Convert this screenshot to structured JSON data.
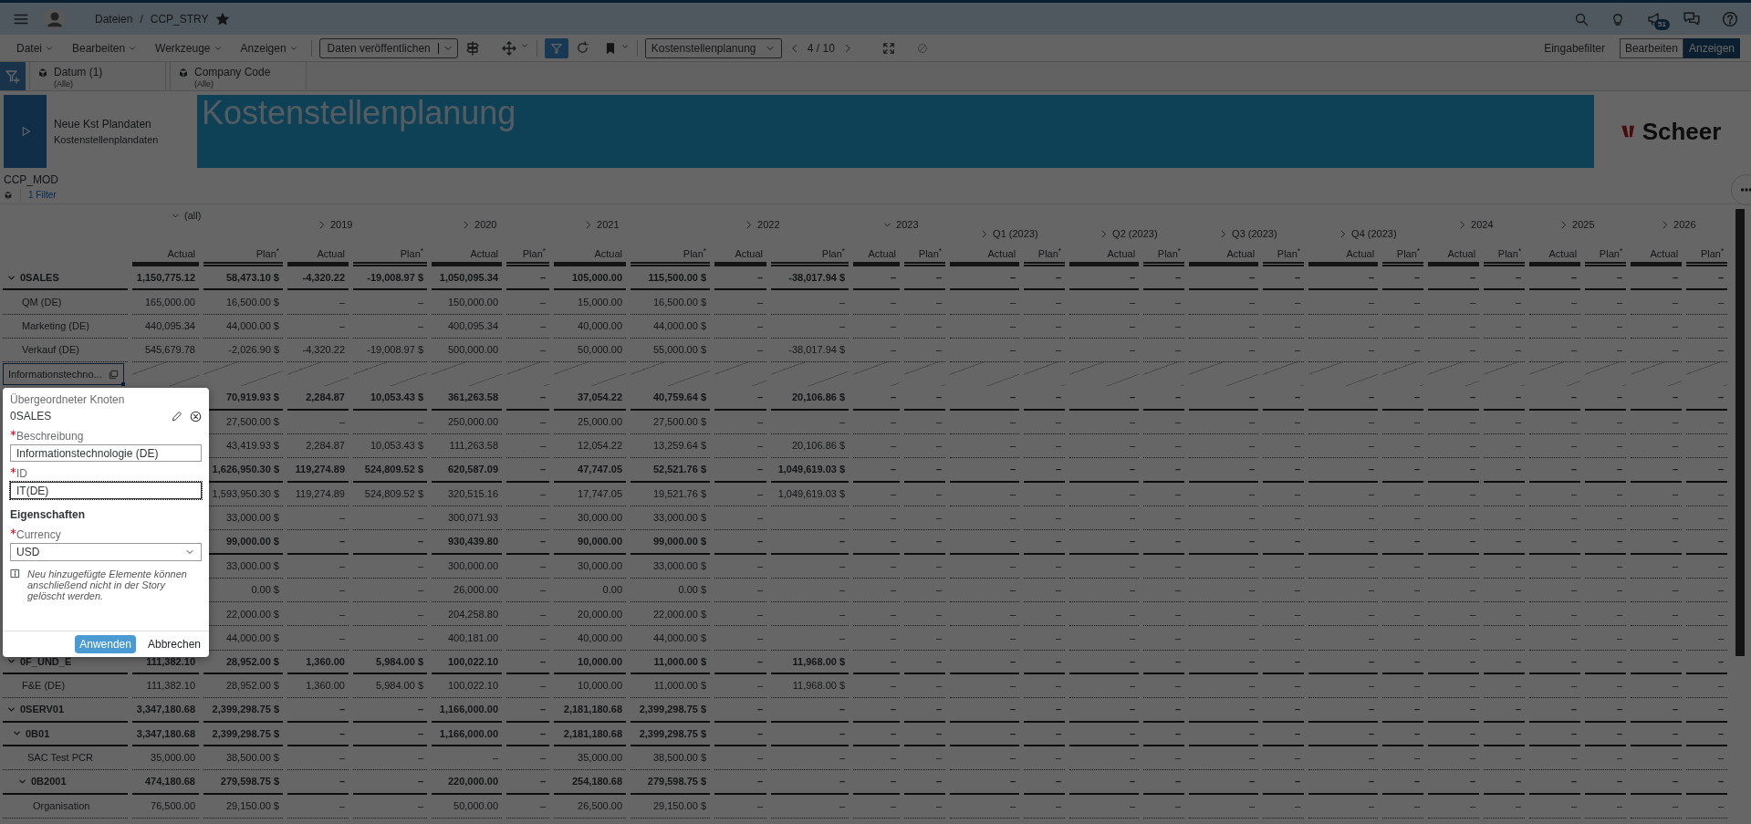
{
  "shell": {
    "breadcrumb": [
      "Dateien",
      "CCP_STRY"
    ],
    "separator": "/",
    "favorite": true,
    "badge": "51"
  },
  "menus": [
    "Datei",
    "Bearbeiten",
    "Werkzeuge",
    "Anzeigen"
  ],
  "toolbar": {
    "publish": "Daten veröffentlichen",
    "filter_active": true,
    "page": "Kostenstellenplanung",
    "pager": "4 / 10",
    "input_filter": "Eingabefilter",
    "modes": [
      {
        "label": "Bearbeiten",
        "selected": false
      },
      {
        "label": "Anzeigen",
        "selected": true
      }
    ]
  },
  "filters": [
    {
      "label": "Datum (1)",
      "value": "(Alle)"
    },
    {
      "label": "Company Code",
      "value": "(Alle)"
    }
  ],
  "story": {
    "title": "Neue Kst Plandaten",
    "subtitle": "Kostenstellenplandaten",
    "banner": "Kostenstellenplanung",
    "logo": "Scheer"
  },
  "table": {
    "title": "CCP_MOD",
    "filter_label": "1 Filter",
    "columns": {
      "label": "(all)",
      "expanded": true,
      "measures": [
        "Actual",
        "Plan$^{*}$"
      ],
      "children": [
        {
          "label": "2019",
          "expanded": false,
          "measures": [
            "Actual",
            "Plan$^{*}$"
          ]
        },
        {
          "label": "2020",
          "expanded": false,
          "measures": [
            "Actual",
            "Plan$^{*}$"
          ]
        },
        {
          "label": "2021",
          "expanded": false,
          "measures": [
            "Actual",
            "Plan$^{*}$"
          ]
        },
        {
          "label": "2022",
          "expanded": false,
          "measures": [
            "Actual",
            "Plan$^{*}$"
          ]
        },
        {
          "label": "2023",
          "expanded": true,
          "measures": [
            "Actual",
            "Plan$^{*}$"
          ],
          "children": [
            {
              "label": "Q1 (2023)",
              "expanded": false,
              "measures": [
                "Actual",
                "Plan$^{*}$"
              ]
            },
            {
              "label": "Q2 (2023)",
              "expanded": false,
              "measures": [
                "Actual",
                "Plan$^{*}$"
              ]
            },
            {
              "label": "Q3 (2023)",
              "expanded": false,
              "measures": [
                "Actual",
                "Plan$^{*}$"
              ]
            },
            {
              "label": "Q4 (2023)",
              "expanded": false,
              "measures": [
                "Actual",
                "Plan$^{*}$"
              ]
            }
          ]
        },
        {
          "label": "2024",
          "expanded": false,
          "measures": [
            "Actual",
            "Plan$^{*}$"
          ]
        },
        {
          "label": "2025",
          "expanded": false,
          "measures": [
            "Actual",
            "Plan$^{*}$"
          ]
        },
        {
          "label": "2026",
          "expanded": false,
          "measures": [
            "Actual",
            "Plan$^{*}$"
          ]
        }
      ]
    },
    "rows": [
      {
        "kind": "node",
        "label": "0SALES",
        "expanded": true,
        "cells": [
          "1,150,775.12",
          "58,473.10 $",
          "-4,320.22",
          "-19,008.97 $",
          "1,050,095.34",
          "–",
          "105,000.00",
          "115,500.00 $",
          "–",
          "-38,017.94 $",
          "–",
          "–",
          "–",
          "–",
          "–",
          "–",
          "–",
          "–",
          "–",
          "–",
          "–",
          "–",
          "–",
          "–",
          "–",
          "–"
        ],
        "children": [
          {
            "kind": "node",
            "label": "QM (DE)",
            "cells": [
              "165,000.00",
              "16,500.00 $",
              "–",
              "–",
              "150,000.00",
              "–",
              "15,000.00",
              "16,500.00 $",
              "–",
              "–",
              "–",
              "–",
              "–",
              "–",
              "–",
              "–",
              "–",
              "–",
              "–",
              "–",
              "–",
              "–",
              "–",
              "–",
              "–",
              "–"
            ]
          },
          {
            "kind": "node",
            "label": "Marketing (DE)",
            "cells": [
              "440,095.34",
              "44,000.00 $",
              "–",
              "–",
              "400,095.34",
              "–",
              "40,000.00",
              "44,000.00 $",
              "–",
              "–",
              "–",
              "–",
              "–",
              "–",
              "–",
              "–",
              "–",
              "–",
              "–",
              "–",
              "–",
              "–",
              "–",
              "–",
              "–",
              "–"
            ]
          },
          {
            "kind": "node",
            "label": "Verkauf (DE)",
            "cells": [
              "545,679.78",
              "-2,026.90 $",
              "-4,320.22",
              "-19,008.97 $",
              "500,000.00",
              "–",
              "50,000.00",
              "55,000.00 $",
              "–",
              "-38,017.94 $",
              "–",
              "–",
              "–",
              "–",
              "–",
              "–",
              "–",
              "–",
              "–",
              "–",
              "–",
              "–",
              "–",
              "–",
              "–",
              "–"
            ]
          },
          {
            "kind": "new",
            "label": "Informationstechno..."
          }
        ]
      },
      {
        "kind": "node",
        "cells": [
          null,
          "70,919.93 $",
          "2,284.87",
          "10,053.43 $",
          "361,263.58",
          "–",
          "37,054.22",
          "40,759.64 $",
          "–",
          "20,106.86 $",
          "–",
          "–",
          "–",
          "–",
          "–",
          "–",
          "–",
          "–",
          "–",
          "–",
          "–",
          "–",
          "–",
          "–",
          "–",
          "–"
        ],
        "children": [
          {
            "kind": "node",
            "cells": [
              null,
              "27,500.00 $",
              "–",
              "–",
              "250,000.00",
              "–",
              "25,000.00",
              "27,500.00 $",
              "–",
              "–",
              "–",
              "–",
              "–",
              "–",
              "–",
              "–",
              "–",
              "–",
              "–",
              "–",
              "–",
              "–",
              "–",
              "–",
              "–",
              "–"
            ]
          },
          {
            "kind": "node",
            "cells": [
              null,
              "43,419.93 $",
              "2,284.87",
              "10,053.43 $",
              "111,263.58",
              "–",
              "12,054.22",
              "13,259.64 $",
              "–",
              "20,106.86 $",
              "–",
              "–",
              "–",
              "–",
              "–",
              "–",
              "–",
              "–",
              "–",
              "–",
              "–",
              "–",
              "–",
              "–",
              "–",
              "–"
            ]
          }
        ]
      },
      {
        "kind": "node",
        "cells": [
          null,
          "1,626,950.30 $",
          "119,274.89",
          "524,809.52 $",
          "620,587.09",
          "–",
          "47,747.05",
          "52,521.76 $",
          "–",
          "1,049,619.03 $",
          "–",
          "–",
          "–",
          "–",
          "–",
          "–",
          "–",
          "–",
          "–",
          "–",
          "–",
          "–",
          "–",
          "–",
          "–",
          "–"
        ],
        "children": [
          {
            "kind": "node",
            "cells": [
              null,
              "1,593,950.30 $",
              "119,274.89",
              "524,809.52 $",
              "320,515.16",
              "–",
              "17,747.05",
              "19,521.76 $",
              "–",
              "1,049,619.03 $",
              "–",
              "–",
              "–",
              "–",
              "–",
              "–",
              "–",
              "–",
              "–",
              "–",
              "–",
              "–",
              "–",
              "–",
              "–",
              "–"
            ]
          },
          {
            "kind": "node",
            "cells": [
              null,
              "33,000.00 $",
              "–",
              "–",
              "300,071.93",
              "–",
              "30,000.00",
              "33,000.00 $",
              "–",
              "–",
              "–",
              "–",
              "–",
              "–",
              "–",
              "–",
              "–",
              "–",
              "–",
              "–",
              "–",
              "–",
              "–",
              "–",
              "–",
              "–"
            ]
          }
        ]
      },
      {
        "kind": "node",
        "cells": [
          null,
          "99,000.00 $",
          "–",
          "–",
          "930,439.80",
          "–",
          "90,000.00",
          "99,000.00 $",
          "–",
          "–",
          "–",
          "–",
          "–",
          "–",
          "–",
          "–",
          "–",
          "–",
          "–",
          "–",
          "–",
          "–",
          "–",
          "–",
          "–",
          "–"
        ],
        "children": [
          {
            "kind": "node",
            "cells": [
              null,
              "33,000.00 $",
              "–",
              "–",
              "300,000.00",
              "–",
              "30,000.00",
              "33,000.00 $",
              "–",
              "–",
              "–",
              "–",
              "–",
              "–",
              "–",
              "–",
              "–",
              "–",
              "–",
              "–",
              "–",
              "–",
              "–",
              "–",
              "–",
              "–"
            ]
          },
          {
            "kind": "node",
            "cells": [
              null,
              "0.00 $",
              "–",
              "–",
              "26,000.00",
              "–",
              "0.00",
              "0.00 $",
              "–",
              "–",
              "–",
              "–",
              "–",
              "–",
              "–",
              "–",
              "–",
              "–",
              "–",
              "–",
              "–",
              "–",
              "–",
              "–",
              "–",
              "–"
            ]
          },
          {
            "kind": "node",
            "cells": [
              null,
              "22,000.00 $",
              "–",
              "–",
              "204,258.80",
              "–",
              "20,000.00",
              "22,000.00 $",
              "–",
              "–",
              "–",
              "–",
              "–",
              "–",
              "–",
              "–",
              "–",
              "–",
              "–",
              "–",
              "–",
              "–",
              "–",
              "–",
              "–",
              "–"
            ]
          },
          {
            "kind": "node",
            "cells": [
              null,
              "44,000.00 $",
              "–",
              "–",
              "400,181.00",
              "–",
              "40,000.00",
              "44,000.00 $",
              "–",
              "–",
              "–",
              "–",
              "–",
              "–",
              "–",
              "–",
              "–",
              "–",
              "–",
              "–",
              "–",
              "–",
              "–",
              "–",
              "–",
              "–"
            ]
          }
        ]
      },
      {
        "kind": "node",
        "label": "0F_UND_E",
        "expanded": true,
        "cells": [
          "111,382.10",
          "28,952.00 $",
          "1,360.00",
          "5,984.00 $",
          "100,022.10",
          "–",
          "10,000.00",
          "11,000.00 $",
          "–",
          "11,968.00 $",
          "–",
          "–",
          "–",
          "–",
          "–",
          "–",
          "–",
          "–",
          "–",
          "–",
          "–",
          "–",
          "–",
          "–",
          "–",
          "–"
        ],
        "children": [
          {
            "kind": "node",
            "label": "F&E (DE)",
            "cells": [
              "111,382.10",
              "28,952.00 $",
              "1,360.00",
              "5,984.00 $",
              "100,022.10",
              "–",
              "10,000.00",
              "11,000.00 $",
              "–",
              "11,968.00 $",
              "–",
              "–",
              "–",
              "–",
              "–",
              "–",
              "–",
              "–",
              "–",
              "–",
              "–",
              "–",
              "–",
              "–",
              "–",
              "–"
            ]
          }
        ]
      },
      {
        "kind": "node",
        "label": "0SERV01",
        "expanded": true,
        "cells": [
          "3,347,180.68",
          "2,399,298.75 $",
          "–",
          "–",
          "1,166,000.00",
          "–",
          "2,181,180.68",
          "2,399,298.75 $",
          "–",
          "–",
          "–",
          "–",
          "–",
          "–",
          "–",
          "–",
          "–",
          "–",
          "–",
          "–",
          "–",
          "–",
          "–",
          "–",
          "–",
          "–"
        ],
        "children": [
          {
            "kind": "node",
            "label": "0B01",
            "expanded": true,
            "cells": [
              "3,347,180.68",
              "2,399,298.75 $",
              "–",
              "–",
              "1,166,000.00",
              "–",
              "2,181,180.68",
              "2,399,298.75 $",
              "–",
              "–",
              "–",
              "–",
              "–",
              "–",
              "–",
              "–",
              "–",
              "–",
              "–",
              "–",
              "–",
              "–",
              "–",
              "–",
              "–",
              "–"
            ],
            "children": [
              {
                "kind": "node",
                "label": "SAC Test PCR",
                "cells": [
                  "35,000.00",
                  "38,500.00 $",
                  "–",
                  "–",
                  "–",
                  "–",
                  "35,000.00",
                  "38,500.00 $",
                  "–",
                  "–",
                  "–",
                  "–",
                  "–",
                  "–",
                  "–",
                  "–",
                  "–",
                  "–",
                  "–",
                  "–",
                  "–",
                  "–",
                  "–",
                  "–",
                  "–",
                  "–"
                ]
              },
              {
                "kind": "node",
                "label": "0B2001",
                "expanded": true,
                "cells": [
                  "474,180.68",
                  "279,598.75 $",
                  "–",
                  "–",
                  "220,000.00",
                  "–",
                  "254,180.68",
                  "279,598.75 $",
                  "–",
                  "–",
                  "–",
                  "–",
                  "–",
                  "–",
                  "–",
                  "–",
                  "–",
                  "–",
                  "–",
                  "–",
                  "–",
                  "–",
                  "–",
                  "–",
                  "–",
                  "–"
                ],
                "children": [
                  {
                    "kind": "node",
                    "label": "Organisation",
                    "cells": [
                      "76,500.00",
                      "29,150.00 $",
                      "–",
                      "–",
                      "50,000.00",
                      "–",
                      "26,500.00",
                      "29,150.00 $",
                      "–",
                      "–",
                      "–",
                      "–",
                      "–",
                      "–",
                      "–",
                      "–",
                      "–",
                      "–",
                      "–",
                      "–",
                      "–",
                      "–",
                      "–",
                      "–",
                      "–",
                      "–"
                    ]
                  }
                ]
              }
            ]
          }
        ]
      }
    ]
  },
  "dialog": {
    "parent_label": "Übergeordneter Knoten",
    "parent_value": "0SALES",
    "fields": [
      {
        "label": "Beschreibung",
        "required": true,
        "value": "Informationstechnologie (DE)",
        "focused": false
      },
      {
        "label": "ID",
        "required": true,
        "value": "IT(DE)",
        "focused": true
      }
    ],
    "section": "Eigenschaften",
    "properties": [
      {
        "label": "Currency",
        "required": true,
        "value": "USD"
      }
    ],
    "note": "Neu hinzugefügte Elemente können anschließend nicht in der Story gelöscht werden.",
    "buttons": [
      {
        "label": "Anwenden",
        "primary": true
      },
      {
        "label": "Abbrechen",
        "primary": false
      }
    ]
  }
}
